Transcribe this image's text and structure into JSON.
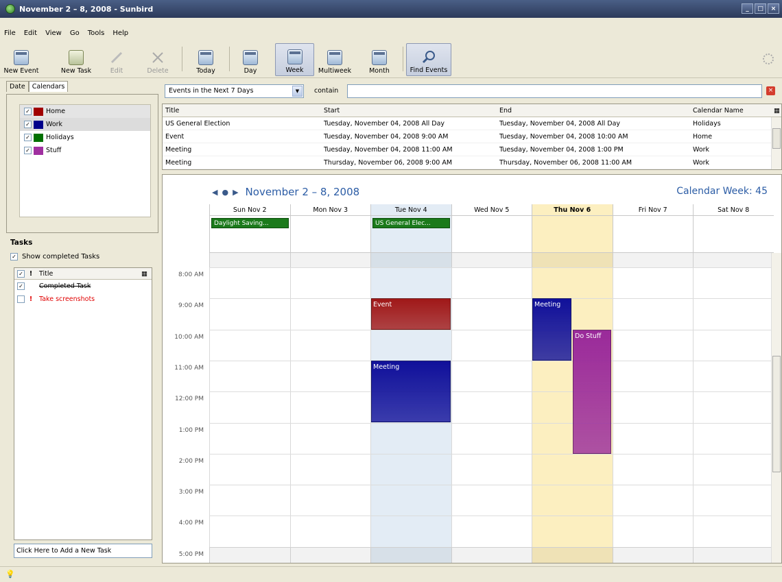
{
  "window": {
    "title": "November 2 – 8, 2008 - Sunbird"
  },
  "menu": [
    "File",
    "Edit",
    "View",
    "Go",
    "Tools",
    "Help"
  ],
  "toolbar": {
    "new_event": "New Event",
    "new_task": "New Task",
    "edit": "Edit",
    "delete": "Delete",
    "today": "Today",
    "day": "Day",
    "week": "Week",
    "multiweek": "Multiweek",
    "month": "Month",
    "find_events": "Find Events"
  },
  "left_tabs": {
    "date": "Date",
    "calendars": "Calendars"
  },
  "calendars": [
    {
      "name": "Home",
      "color": "#a00000",
      "checked": true
    },
    {
      "name": "Work",
      "color": "#00008b",
      "checked": true
    },
    {
      "name": "Holidays",
      "color": "#007000",
      "checked": true
    },
    {
      "name": "Stuff",
      "color": "#a030a0",
      "checked": true
    }
  ],
  "tasks": {
    "heading": "Tasks",
    "show_completed": "Show completed Tasks",
    "col_priority": "!",
    "col_title": "Title",
    "items": [
      {
        "title": "Completed Task",
        "completed": true,
        "priority": ""
      },
      {
        "title": "Take screenshots",
        "completed": false,
        "priority": "!"
      }
    ],
    "add_placeholder": "Click Here to Add a New Task"
  },
  "filter": {
    "selected": "Events in the Next 7 Days",
    "contain_label": "contain",
    "search_value": ""
  },
  "event_list": {
    "headers": [
      "Title",
      "Start",
      "End",
      "Calendar Name"
    ],
    "rows": [
      [
        "US General Election",
        "Tuesday, November 04, 2008 All Day",
        "Tuesday, November 04, 2008 All Day",
        "Holidays"
      ],
      [
        "Event",
        "Tuesday, November 04, 2008 9:00 AM",
        "Tuesday, November 04, 2008 10:00 AM",
        "Home"
      ],
      [
        "Meeting",
        "Tuesday, November 04, 2008 11:00 AM",
        "Tuesday, November 04, 2008 1:00 PM",
        "Work"
      ],
      [
        "Meeting",
        "Thursday, November 06, 2008 9:00 AM",
        "Thursday, November 06, 2008 11:00 AM",
        "Work"
      ]
    ]
  },
  "week_view": {
    "title": "November 2 – 8, 2008",
    "calendar_week": "Calendar Week: 45",
    "days": [
      "Sun Nov 2",
      "Mon Nov 3",
      "Tue Nov 4",
      "Wed Nov 5",
      "Thu Nov 6",
      "Fri Nov 7",
      "Sat Nov 8"
    ],
    "all_day": [
      {
        "day": 0,
        "label": "Daylight Saving..."
      },
      {
        "day": 2,
        "label": "US General Elec..."
      }
    ],
    "times": [
      "8:00 AM",
      "9:00 AM",
      "10:00 AM",
      "11:00 AM",
      "12:00 PM",
      "1:00 PM",
      "2:00 PM",
      "3:00 PM",
      "4:00 PM",
      "5:00 PM"
    ],
    "events": [
      {
        "label": "Event",
        "day": 2,
        "start": 9,
        "end": 10,
        "color": "#a01818"
      },
      {
        "label": "Meeting",
        "day": 2,
        "start": 11,
        "end": 13,
        "color": "#10109a"
      },
      {
        "label": "Meeting",
        "day": 4,
        "start": 9,
        "end": 11,
        "color": "#10109a"
      },
      {
        "label": "Do Stuff",
        "day": 4,
        "start": 10,
        "end": 14,
        "color": "#9a2a9a"
      }
    ]
  }
}
